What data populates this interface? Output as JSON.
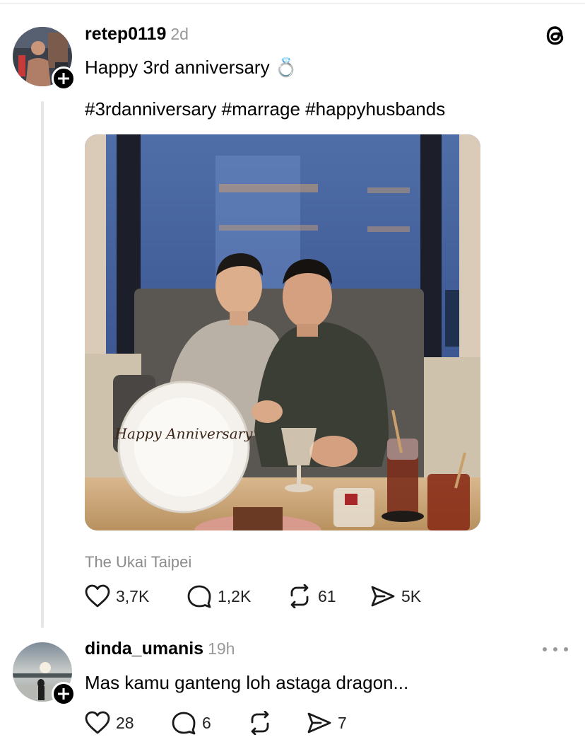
{
  "post": {
    "username": "retep0119",
    "time": "2d",
    "text": "Happy 3rd anniversary 💍",
    "hashtags": "#3rdanniversary #marrage #happyhusbands",
    "location": "The Ukai Taipei",
    "plate_text": "Happy Anniversary",
    "stats": {
      "likes": "3,7K",
      "replies": "1,2K",
      "reposts": "61",
      "shares": "5K"
    }
  },
  "reply": {
    "username": "dinda_umanis",
    "time": "19h",
    "text": "Mas kamu ganteng loh astaga dragon...",
    "stats": {
      "likes": "28",
      "replies": "6",
      "shares": "7"
    }
  },
  "icons": {
    "app_logo": "threads-logo-icon",
    "like": "heart-icon",
    "reply": "comment-bubble-icon",
    "repost": "repost-icon",
    "share": "send-icon",
    "more": "more-dots-icon",
    "follow": "plus-icon"
  },
  "colors": {
    "text": "#000000",
    "muted": "#999999",
    "divider": "#e6e6e6"
  }
}
